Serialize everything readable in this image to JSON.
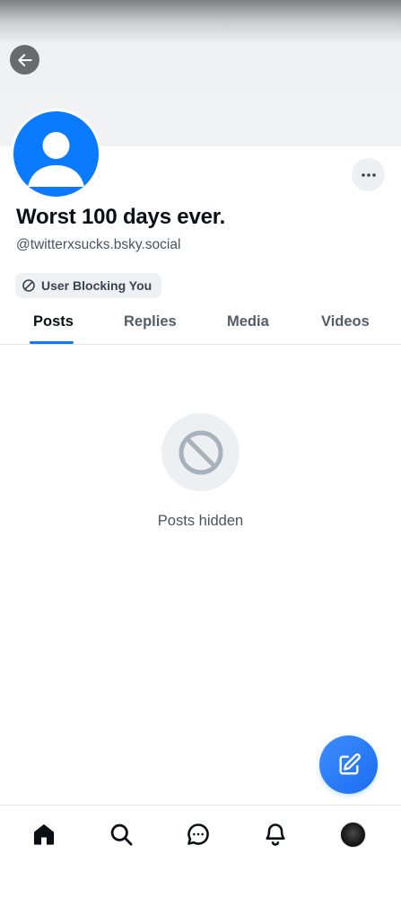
{
  "profile": {
    "display_name": "Worst 100 days ever.",
    "handle": "@twitterxsucks.bsky.social",
    "blocking_badge": "User Blocking You"
  },
  "tabs": [
    {
      "label": "Posts",
      "active": true
    },
    {
      "label": "Replies",
      "active": false
    },
    {
      "label": "Media",
      "active": false
    },
    {
      "label": "Videos",
      "active": false
    }
  ],
  "empty_state": {
    "message": "Posts hidden",
    "icon": "ban-icon"
  },
  "icons": {
    "back": "arrow-left-icon",
    "more": "more-horizontal-icon",
    "fab": "compose-icon",
    "nav": [
      "home-icon",
      "search-icon",
      "chat-icon",
      "bell-icon",
      "user-avatar"
    ]
  },
  "colors": {
    "accent": "#0a7aff",
    "avatar_bg": "#0a7aff",
    "text_primary": "#0b0f14",
    "text_secondary": "#4a5360"
  }
}
